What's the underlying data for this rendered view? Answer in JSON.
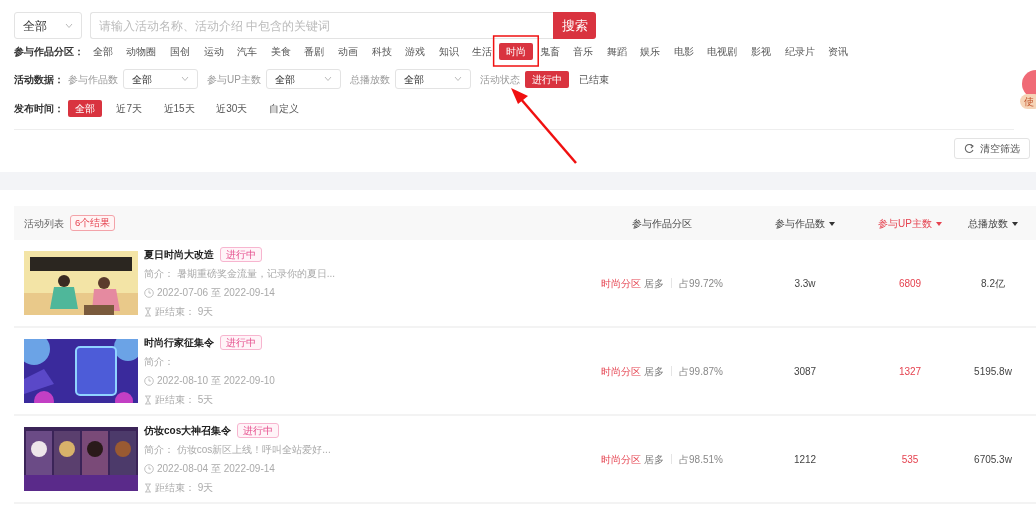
{
  "scope_select": {
    "value": "全部"
  },
  "search": {
    "placeholder": "请输入活动名称、活动介绍 中包含的关键词",
    "button": "搜索"
  },
  "category_filter": {
    "label": "参与作品分区：",
    "options": [
      {
        "label": "全部",
        "selected": false
      },
      {
        "label": "动物圈",
        "selected": false
      },
      {
        "label": "国创",
        "selected": false
      },
      {
        "label": "运动",
        "selected": false
      },
      {
        "label": "汽车",
        "selected": false
      },
      {
        "label": "美食",
        "selected": false
      },
      {
        "label": "番剧",
        "selected": false
      },
      {
        "label": "动画",
        "selected": false
      },
      {
        "label": "科技",
        "selected": false
      },
      {
        "label": "游戏",
        "selected": false
      },
      {
        "label": "知识",
        "selected": false
      },
      {
        "label": "生活",
        "selected": false
      },
      {
        "label": "时尚",
        "selected": true
      },
      {
        "label": "鬼畜",
        "selected": false
      },
      {
        "label": "音乐",
        "selected": false
      },
      {
        "label": "舞蹈",
        "selected": false
      },
      {
        "label": "娱乐",
        "selected": false
      },
      {
        "label": "电影",
        "selected": false
      },
      {
        "label": "电视剧",
        "selected": false
      },
      {
        "label": "影视",
        "selected": false
      },
      {
        "label": "纪录片",
        "selected": false
      },
      {
        "label": "资讯",
        "selected": false
      }
    ]
  },
  "data_filter": {
    "label": "活动数据：",
    "fields": [
      {
        "label": "参与作品数",
        "value": "全部"
      },
      {
        "label": "参与UP主数",
        "value": "全部"
      },
      {
        "label": "总播放数",
        "value": "全部"
      }
    ],
    "status": {
      "label": "活动状态",
      "options": [
        {
          "label": "进行中",
          "selected": true
        },
        {
          "label": "已结束",
          "selected": false
        }
      ]
    }
  },
  "time_filter": {
    "label": "发布时间：",
    "options": [
      {
        "label": "全部",
        "selected": true
      },
      {
        "label": "近7天",
        "selected": false
      },
      {
        "label": "近15天",
        "selected": false
      },
      {
        "label": "近30天",
        "selected": false
      },
      {
        "label": "自定义",
        "selected": false
      }
    ]
  },
  "clear_button": "清空筛选",
  "float_widget": {
    "label": "使"
  },
  "list": {
    "title": "活动列表",
    "count": "6个结果",
    "columns": [
      {
        "label": "参与作品分区",
        "sortable": false,
        "selected": false
      },
      {
        "label": "参与作品数",
        "sortable": true,
        "selected": false
      },
      {
        "label": "参与UP主数",
        "sortable": true,
        "selected": true
      },
      {
        "label": "总播放数",
        "sortable": true,
        "selected": false
      }
    ],
    "rows": [
      {
        "title": "夏日时尚大改造",
        "status": "进行中",
        "intro_label": "简介：",
        "intro": "暑期重磅奖金流量，记录你的夏日...",
        "date": "2022-07-06 至 2022-09-14",
        "remaining_label": "距结束：",
        "remaining": "9天",
        "area": "时尚分区",
        "area_note": "居多",
        "share": "占99.72%",
        "works": "3.3w",
        "ups": "6809",
        "plays": "8.2亿"
      },
      {
        "title": "时尚行家征集令",
        "status": "进行中",
        "intro_label": "简介：",
        "date": "2022-08-10 至 2022-09-10",
        "remaining_label": "距结束：",
        "remaining": "5天",
        "area": "时尚分区",
        "area_note": "居多",
        "share": "占99.87%",
        "works": "3087",
        "ups": "1327",
        "plays": "5195.8w"
      },
      {
        "title": "仿妆cos大神召集令",
        "status": "进行中",
        "intro_label": "简介：",
        "intro": "仿妆cos新区上线！呼叫全站爱好...",
        "date": "2022-08-04 至 2022-09-14",
        "remaining_label": "距结束：",
        "remaining": "9天",
        "area": "时尚分区",
        "area_note": "居多",
        "share": "占98.51%",
        "works": "1212",
        "ups": "535",
        "plays": "6705.3w"
      }
    ]
  }
}
